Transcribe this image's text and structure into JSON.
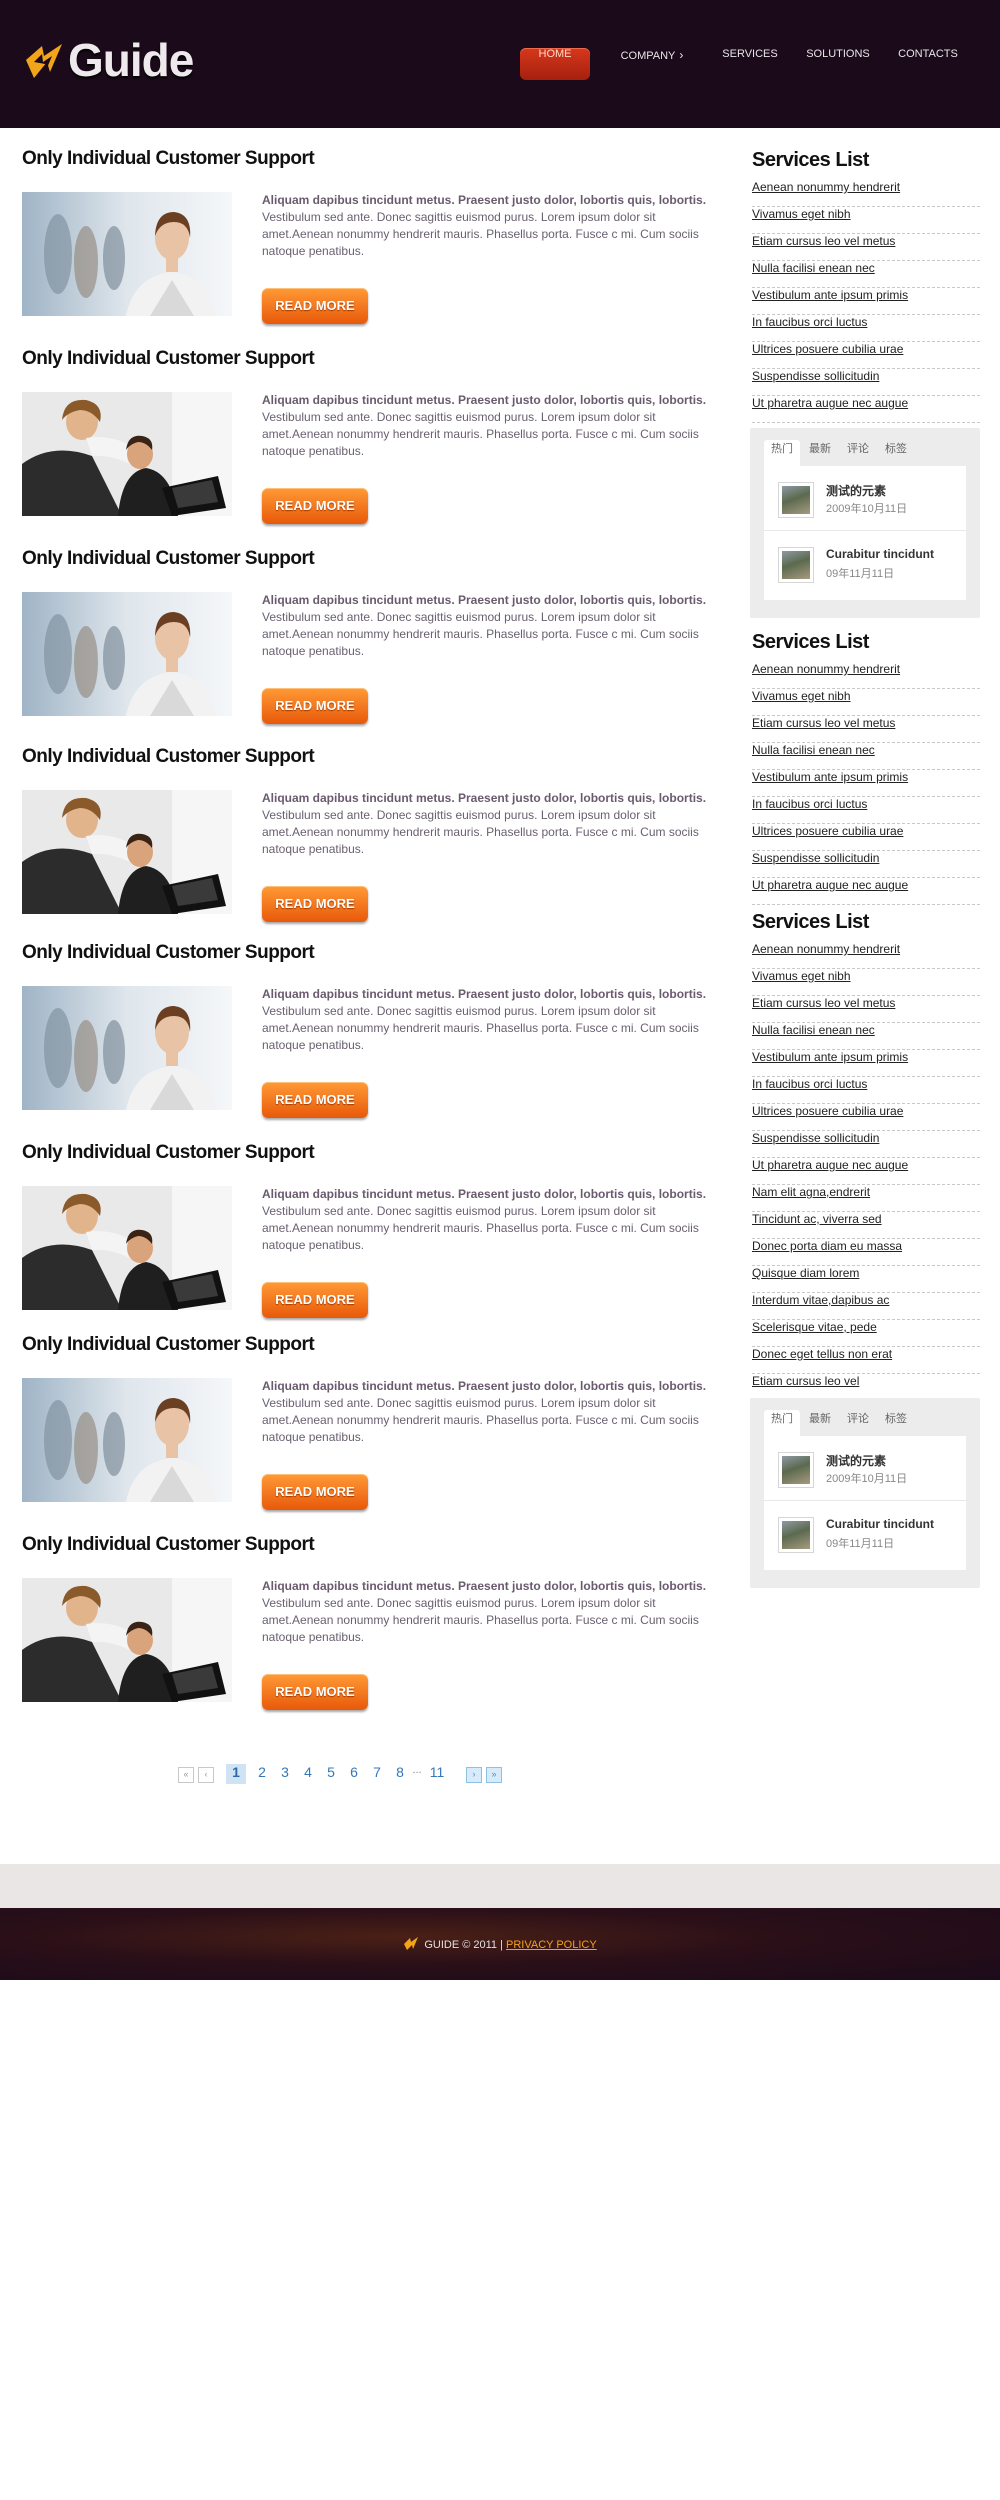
{
  "site": {
    "logo_text": "Guide",
    "colors": {
      "header_bg": "#1b0b1a",
      "accent": "#f07318",
      "nav_active": "#c72c15",
      "link_blue": "#3577b8"
    }
  },
  "nav": [
    {
      "label": "HOME",
      "active": true
    },
    {
      "label": "COMPANY",
      "icon": "chevron-right-icon"
    },
    {
      "label": "SERVICES"
    },
    {
      "label": "SOLUTIONS"
    },
    {
      "label": "CONTACTS"
    }
  ],
  "posts": [
    {
      "title": "Only Individual Customer Support",
      "image": "woman-portrait",
      "lead": "Aliquam dapibus tincidunt metus. Praesent justo dolor, lobortis quis, lobortis.",
      "body": "Vestibulum sed ante. Donec sagittis euismod purus. Lorem ipsum dolor sit amet.Aenean nonummy hendrerit mauris. Phasellus porta. Fusce c mi. Cum sociis natoque penatibus.",
      "button": "READ MORE"
    },
    {
      "title": "Only Individual Customer Support",
      "image": "team-at-laptop",
      "lead": "Aliquam dapibus tincidunt metus. Praesent justo dolor, lobortis quis, lobortis.",
      "body": "Vestibulum sed ante. Donec sagittis euismod purus. Lorem ipsum dolor sit amet.Aenean nonummy hendrerit mauris. Phasellus porta. Fusce c mi. Cum sociis natoque penatibus.",
      "button": "READ MORE"
    },
    {
      "title": "Only Individual Customer Support",
      "image": "woman-portrait",
      "lead": "Aliquam dapibus tincidunt metus. Praesent justo dolor, lobortis quis, lobortis.",
      "body": "Vestibulum sed ante. Donec sagittis euismod purus. Lorem ipsum dolor sit amet.Aenean nonummy hendrerit mauris. Phasellus porta. Fusce c mi. Cum sociis natoque penatibus.",
      "button": "READ MORE"
    },
    {
      "title": "Only Individual Customer Support",
      "image": "team-at-laptop",
      "lead": "Aliquam dapibus tincidunt metus. Praesent justo dolor, lobortis quis, lobortis.",
      "body": "Vestibulum sed ante. Donec sagittis euismod purus. Lorem ipsum dolor sit amet.Aenean nonummy hendrerit mauris. Phasellus porta. Fusce c mi. Cum sociis natoque penatibus.",
      "button": "READ MORE"
    },
    {
      "title": "Only Individual Customer Support",
      "image": "woman-portrait",
      "lead": "Aliquam dapibus tincidunt metus. Praesent justo dolor, lobortis quis, lobortis.",
      "body": "Vestibulum sed ante. Donec sagittis euismod purus. Lorem ipsum dolor sit amet.Aenean nonummy hendrerit mauris. Phasellus porta. Fusce c mi. Cum sociis natoque penatibus.",
      "button": "READ MORE"
    },
    {
      "title": "Only Individual Customer Support",
      "image": "team-at-laptop",
      "lead": "Aliquam dapibus tincidunt metus. Praesent justo dolor, lobortis quis, lobortis.",
      "body": "Vestibulum sed ante. Donec sagittis euismod purus. Lorem ipsum dolor sit amet.Aenean nonummy hendrerit mauris. Phasellus porta. Fusce c mi. Cum sociis natoque penatibus.",
      "button": "READ MORE"
    },
    {
      "title": "Only Individual Customer Support",
      "image": "woman-portrait",
      "lead": "Aliquam dapibus tincidunt metus. Praesent justo dolor, lobortis quis, lobortis.",
      "body": "Vestibulum sed ante. Donec sagittis euismod purus. Lorem ipsum dolor sit amet.Aenean nonummy hendrerit mauris. Phasellus porta. Fusce c mi. Cum sociis natoque penatibus.",
      "button": "READ MORE"
    },
    {
      "title": "Only Individual Customer Support",
      "image": "team-at-laptop",
      "lead": "Aliquam dapibus tincidunt metus. Praesent justo dolor, lobortis quis, lobortis.",
      "body": "Vestibulum sed ante. Donec sagittis euismod purus. Lorem ipsum dolor sit amet.Aenean nonummy hendrerit mauris. Phasellus porta. Fusce c mi. Cum sociis natoque penatibus.",
      "button": "READ MORE"
    }
  ],
  "pagination": {
    "first": "«",
    "prev": "‹",
    "current": "1",
    "pages": [
      "2",
      "3",
      "4",
      "5",
      "6",
      "7",
      "8"
    ],
    "ellipsis": "...",
    "last_page": "11",
    "next": "›",
    "last": "»"
  },
  "sidebar": {
    "services_1": {
      "title": "Services List",
      "items": [
        "Aenean nonummy hendrerit",
        "Vivamus eget nibh",
        "Etiam cursus leo vel metus",
        "Nulla facilisi enean nec",
        "Vestibulum ante ipsum primis",
        "In faucibus orci luctus",
        "Ultrices posuere cubilia urae",
        "Suspendisse sollicitudin",
        "Ut pharetra augue nec augue"
      ]
    },
    "tabs_1": {
      "tabs": [
        "热门",
        "最新",
        "评论",
        "标签"
      ],
      "entries": [
        {
          "title": "测试的元素",
          "date": "2009年10月11日"
        },
        {
          "title": "Curabitur tincidunt",
          "date": "09年11月11日"
        }
      ]
    },
    "services_2": {
      "title": "Services List",
      "items": [
        "Aenean nonummy hendrerit",
        "Vivamus eget nibh",
        "Etiam cursus leo vel metus",
        "Nulla facilisi enean nec",
        "Vestibulum ante ipsum primis",
        "In faucibus orci luctus",
        "Ultrices posuere cubilia urae",
        "Suspendisse sollicitudin",
        "Ut pharetra augue nec augue"
      ]
    },
    "services_3": {
      "title": "Services List",
      "items": [
        "Aenean nonummy hendrerit",
        "Vivamus eget nibh",
        "Etiam cursus leo vel metus",
        "Nulla facilisi enean nec",
        "Vestibulum ante ipsum primis",
        "In faucibus orci luctus",
        "Ultrices posuere cubilia urae",
        "Suspendisse sollicitudin",
        "Ut pharetra augue nec augue",
        "Nam elit agna,endrerit",
        "Tincidunt ac, viverra sed",
        "Donec porta diam eu massa",
        "Quisque diam lorem",
        "Interdum vitae,dapibus ac",
        "Scelerisque vitae, pede",
        "Donec eget tellus non erat",
        "Etiam cursus leo vel"
      ]
    },
    "tabs_2": {
      "tabs": [
        "热门",
        "最新",
        "评论",
        "标签"
      ],
      "entries": [
        {
          "title": "测试的元素",
          "date": "2009年10月11日"
        },
        {
          "title": "Curabitur tincidunt",
          "date": "09年11月11日"
        }
      ]
    }
  },
  "footer": {
    "text": "GUIDE © 2011 |",
    "link": "PRIVACY POLICY"
  }
}
